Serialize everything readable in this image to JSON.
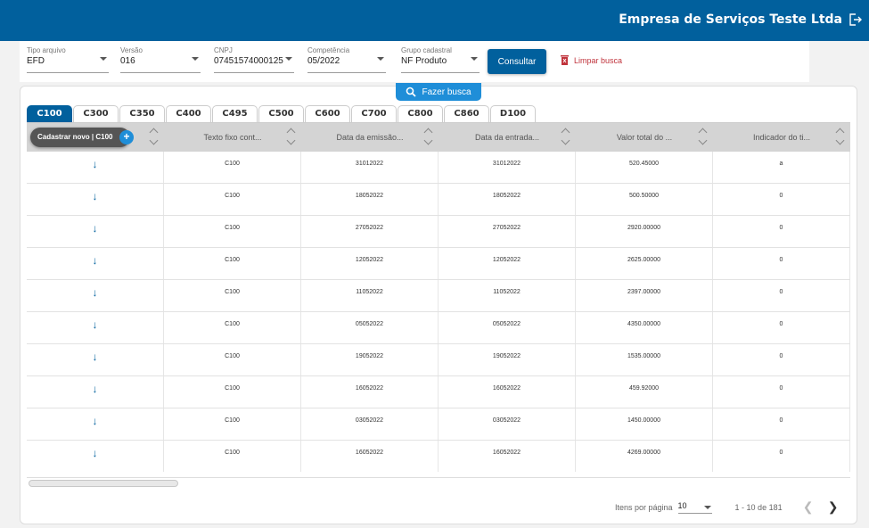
{
  "header": {
    "company": "Empresa de Serviços Teste Ltda",
    "logout_icon": "logout-icon"
  },
  "filters": {
    "tipo_arquivo": {
      "label": "Tipo arquivo",
      "value": "EFD"
    },
    "versao": {
      "label": "Versão",
      "value": "016"
    },
    "cnpj": {
      "label": "CNPJ",
      "value": "07451574000125"
    },
    "competencia": {
      "label": "Competência",
      "value": "05/2022"
    },
    "grupo": {
      "label": "Grupo cadastral",
      "value": "NF Produto"
    },
    "consultar_label": "Consultar",
    "limpar_label": "Limpar busca"
  },
  "search": {
    "label": "Fazer busca"
  },
  "tabs": [
    "C100",
    "C300",
    "C350",
    "C400",
    "C495",
    "C500",
    "C600",
    "C700",
    "C800",
    "C860",
    "D100"
  ],
  "grid": {
    "new_button": "Cadastrar novo | C100",
    "columns": [
      "",
      "Texto fixo cont...",
      "Data da emissão...",
      "Data da entrada...",
      "Valor total do ...",
      "Indicador do ti..."
    ],
    "rows": [
      [
        "C100",
        "31012022",
        "31012022",
        "520.45000",
        "a"
      ],
      [
        "C100",
        "18052022",
        "18052022",
        "500.50000",
        "0"
      ],
      [
        "C100",
        "27052022",
        "27052022",
        "2920.00000",
        "0"
      ],
      [
        "C100",
        "12052022",
        "12052022",
        "2625.00000",
        "0"
      ],
      [
        "C100",
        "11052022",
        "11052022",
        "2397.00000",
        "0"
      ],
      [
        "C100",
        "05052022",
        "05052022",
        "4350.00000",
        "0"
      ],
      [
        "C100",
        "19052022",
        "19052022",
        "1535.00000",
        "0"
      ],
      [
        "C100",
        "16052022",
        "16052022",
        "459.92000",
        "0"
      ],
      [
        "C100",
        "03052022",
        "03052022",
        "1450.00000",
        "0"
      ],
      [
        "C100",
        "16052022",
        "16052022",
        "4269.00000",
        "0"
      ]
    ]
  },
  "pager": {
    "items_label": "Itens por página",
    "page_size": "10",
    "range": "1 - 10 de 181"
  },
  "colors": {
    "primary": "#01609d",
    "accent": "#1f8ed8",
    "danger": "#c0333c"
  }
}
